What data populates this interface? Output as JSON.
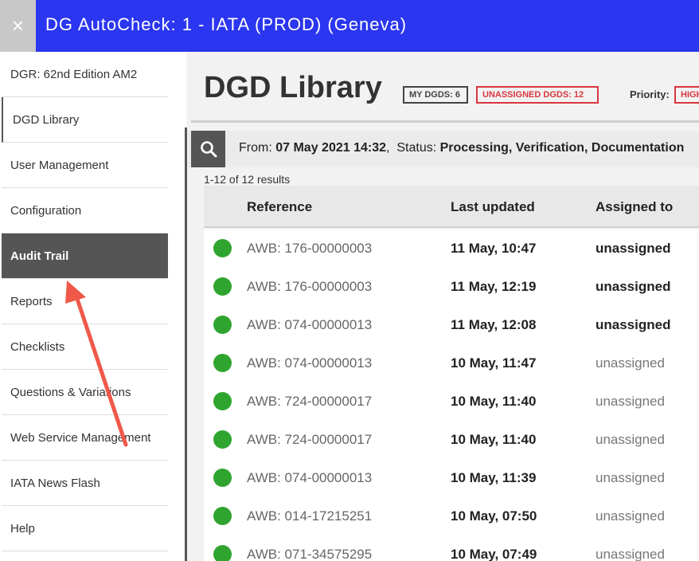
{
  "topbar": {
    "close_symbol": "×",
    "title": "DG AutoCheck: 1 - IATA (PROD) (Geneva)"
  },
  "sidebar": {
    "items": [
      {
        "label": "DGR: 62nd Edition AM2"
      },
      {
        "label": "DGD Library"
      },
      {
        "label": "User Management"
      },
      {
        "label": "Configuration"
      },
      {
        "label": "Audit Trail"
      },
      {
        "label": "Reports"
      },
      {
        "label": "Checklists"
      },
      {
        "label": "Questions & Variations"
      },
      {
        "label": "Web Service Management"
      },
      {
        "label": "IATA News Flash"
      },
      {
        "label": "Help"
      }
    ]
  },
  "main": {
    "title": "DGD Library",
    "badges": {
      "my_dgds": "MY DGDS: 6",
      "unassigned_dgds": "UNASSIGNED DGDS: 12",
      "priority_label": "Priority:",
      "priority_value": "HIGH"
    },
    "filter": {
      "from_label": "From:",
      "from_value": "07 May 2021 14:32",
      "sep": ",",
      "status_label": "Status:",
      "status_value": "Processing, Verification, Documentation"
    },
    "results_count": "1-12 of 12 results",
    "columns": {
      "reference": "Reference",
      "last_updated": "Last updated",
      "assigned_to": "Assigned to"
    },
    "rows": [
      {
        "reference": "AWB: 176-00000003",
        "last_updated": "11 May, 10:47",
        "assigned_to": "unassigned"
      },
      {
        "reference": "AWB: 176-00000003",
        "last_updated": "11 May, 12:19",
        "assigned_to": "unassigned"
      },
      {
        "reference": "AWB: 074-00000013",
        "last_updated": "11 May, 12:08",
        "assigned_to": "unassigned"
      },
      {
        "reference": "AWB: 074-00000013",
        "last_updated": "10 May, 11:47",
        "assigned_to": "unassigned"
      },
      {
        "reference": "AWB: 724-00000017",
        "last_updated": "10 May, 11:40",
        "assigned_to": "unassigned"
      },
      {
        "reference": "AWB: 724-00000017",
        "last_updated": "10 May, 11:40",
        "assigned_to": "unassigned"
      },
      {
        "reference": "AWB: 074-00000013",
        "last_updated": "10 May, 11:39",
        "assigned_to": "unassigned"
      },
      {
        "reference": "AWB: 014-17215251",
        "last_updated": "10 May, 07:50",
        "assigned_to": "unassigned"
      },
      {
        "reference": "AWB: 071-34575295",
        "last_updated": "10 May, 07:49",
        "assigned_to": "unassigned"
      }
    ]
  },
  "colors": {
    "topbar": "#2b36f0",
    "active_nav": "#555555",
    "status_dot": "#2fa52f",
    "alert": "#d9363e",
    "annotation_arrow": "#f0584a"
  },
  "icons": {
    "close": "close-icon",
    "search": "search-icon",
    "status": "status-dot-icon"
  }
}
